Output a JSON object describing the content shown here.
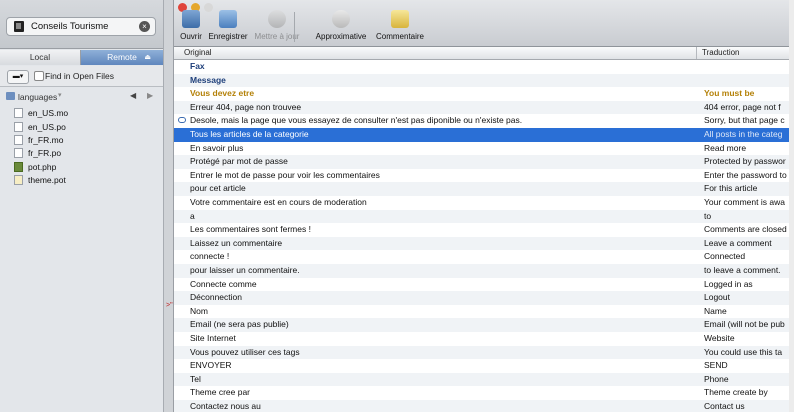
{
  "project": {
    "name": "Conseils Tourisme",
    "close_icon": "close-icon"
  },
  "left_tabs": {
    "local": "Local",
    "remote": "Remote"
  },
  "left_toolbar": {
    "find_label": "Find in Open Files",
    "find_checked": false
  },
  "path": {
    "folder": "languages"
  },
  "files": [
    {
      "name": "en_US.mo",
      "icon": "file-icon"
    },
    {
      "name": "en_US.po",
      "icon": "file-icon"
    },
    {
      "name": "fr_FR.mo",
      "icon": "file-icon"
    },
    {
      "name": "fr_FR.po",
      "icon": "file-icon"
    },
    {
      "name": "pot.php",
      "icon": "php-file-icon"
    },
    {
      "name": "theme.pot",
      "icon": "file-icon"
    }
  ],
  "toolbar": {
    "open": "Ouvrir",
    "save": "Enregistrer",
    "update": "Mettre à jour",
    "fuzzy": "Approximative",
    "comment": "Commentaire"
  },
  "table": {
    "col_original": "Original",
    "col_translation": "Traduction",
    "rows": [
      {
        "original": "Fax",
        "translation": "",
        "kind": "ctx"
      },
      {
        "original": "Message",
        "translation": "",
        "kind": "ctx"
      },
      {
        "original": "Vous devez etre",
        "translation": "You must be",
        "kind": "fuzzy"
      },
      {
        "original": "Erreur 404, page non trouvee",
        "translation": "404 error, page not f",
        "kind": "normal"
      },
      {
        "original": "Desole, mais la page que vous essayez de consulter n'est pas diponible ou n'existe pas.",
        "translation": "Sorry, but that page c",
        "kind": "normal",
        "comment": true
      },
      {
        "original": "Tous les articles de la categorie",
        "translation": "All posts in the categ",
        "kind": "selected"
      },
      {
        "original": "En savoir plus",
        "translation": "Read more",
        "kind": "normal"
      },
      {
        "original": "Protégé par mot de passe",
        "translation": "Protected by passwor",
        "kind": "normal"
      },
      {
        "original": "Entrer le mot de passe pour voir les commentaires",
        "translation": "Enter the password to",
        "kind": "normal"
      },
      {
        "original": "pour cet article",
        "translation": "For this article",
        "kind": "normal"
      },
      {
        "original": "Votre commentaire est en cours de moderation",
        "translation": "Your comment is awa",
        "kind": "normal"
      },
      {
        "original": "a",
        "translation": "to",
        "kind": "normal"
      },
      {
        "original": "Les commentaires sont fermes !",
        "translation": "Comments are closed",
        "kind": "normal"
      },
      {
        "original": "Laissez un commentaire",
        "translation": "Leave a comment",
        "kind": "normal"
      },
      {
        "original": "connecte !",
        "translation": "Connected",
        "kind": "normal"
      },
      {
        "original": "pour laisser un commentaire.",
        "translation": "to leave a comment.",
        "kind": "normal"
      },
      {
        "original": "Connecte comme",
        "translation": "Logged in as",
        "kind": "normal"
      },
      {
        "original": "Déconnection",
        "translation": "Logout",
        "kind": "normal"
      },
      {
        "original": "Nom",
        "translation": "Name",
        "kind": "normal"
      },
      {
        "original": "Email (ne sera pas publie)",
        "translation": "Email (will not be pub",
        "kind": "normal"
      },
      {
        "original": "Site Internet",
        "translation": "Website",
        "kind": "normal"
      },
      {
        "original": "Vous pouvez utiliser ces tags",
        "translation": "You could use this ta",
        "kind": "normal"
      },
      {
        "original": "ENVOYER",
        "translation": "SEND",
        "kind": "normal"
      },
      {
        "original": "Tel",
        "translation": "Phone",
        "kind": "normal"
      },
      {
        "original": "Theme cree par",
        "translation": "Theme create by",
        "kind": "normal"
      },
      {
        "original": "Contactez nous au",
        "translation": "Contact us",
        "kind": "normal"
      }
    ]
  },
  "colors": {
    "selection": "#2a6fd6",
    "fuzzy": "#b48108",
    "context": "#1e3f7a",
    "accent": "#5f86bd"
  }
}
